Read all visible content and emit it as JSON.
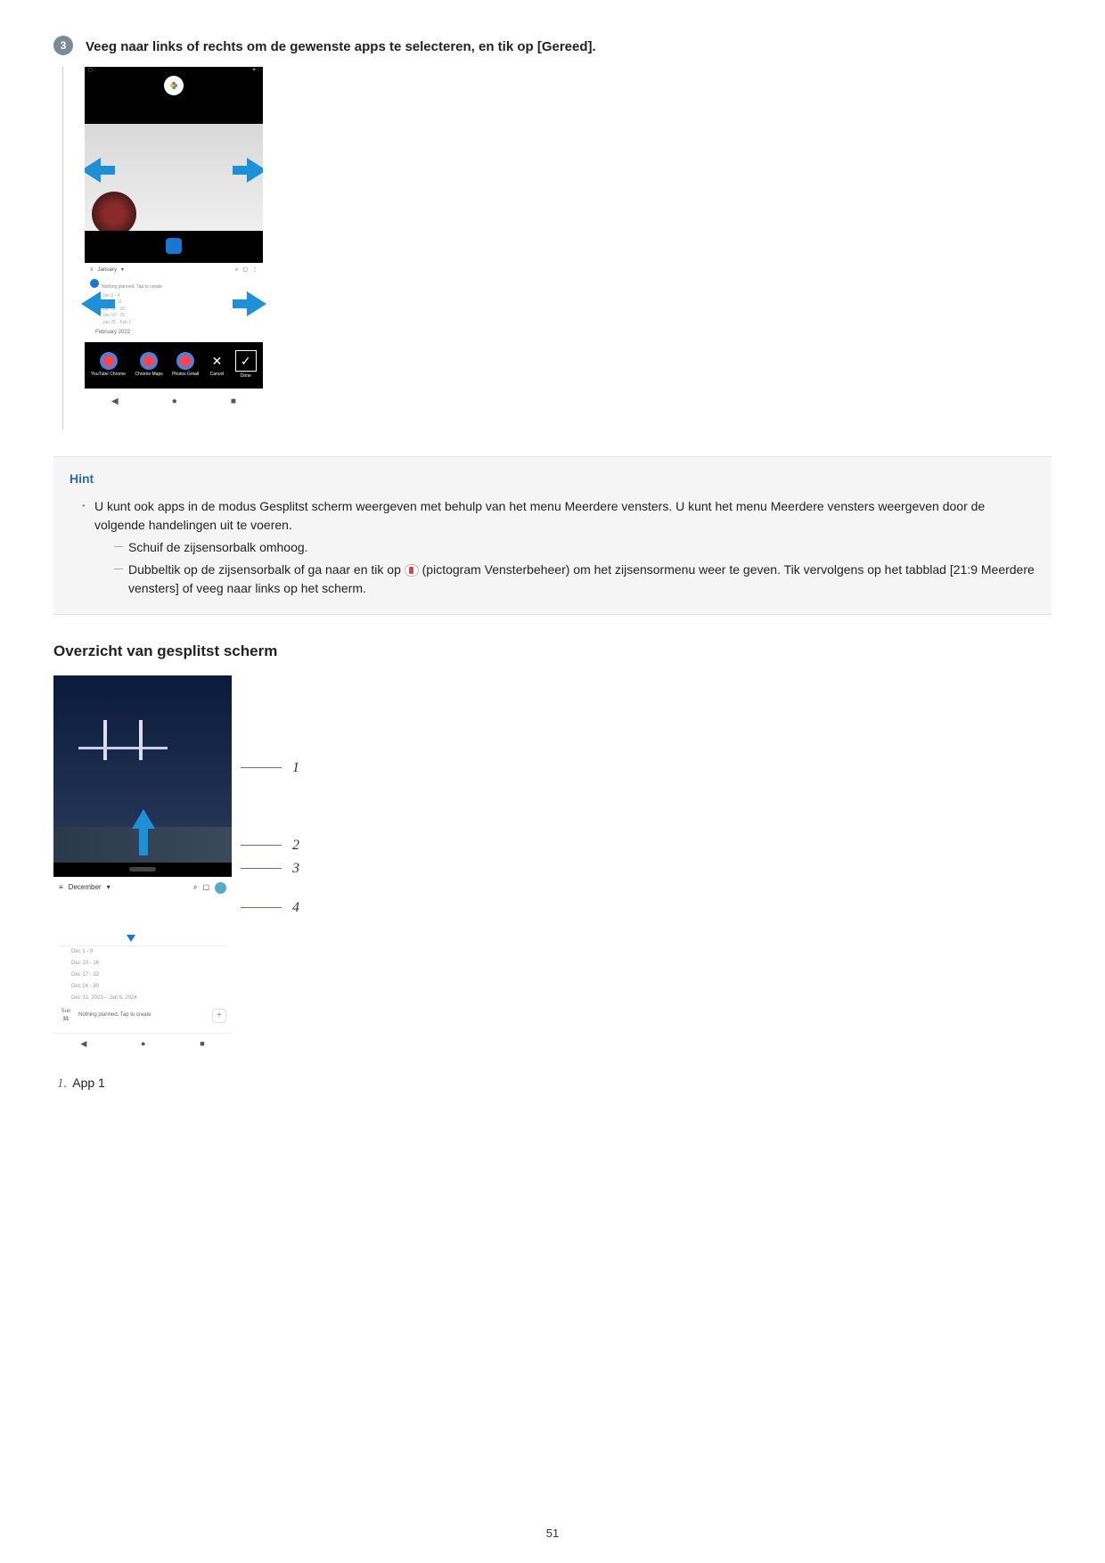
{
  "step3": {
    "number": "3",
    "instruction": "Veeg naar links of rechts om de gewenste apps te selecteren, en tik op [Gereed].",
    "phone": {
      "status_left": "◻ :",
      "status_right": "✦ :",
      "cal_header": "January",
      "cal_subtitle": "Nothing planned. Tap to create",
      "cal_lines": [
        "Jan 1 - 4",
        "Jan 5 - 11",
        "Jan 12 - 18",
        "Jan 19 - 25",
        "Jan 26 - Feb 1"
      ],
      "cal_month": "February 2022",
      "apps": [
        {
          "label": "YouTube Chrome"
        },
        {
          "label": "Chrome Maps"
        },
        {
          "label": "Photos Gmail"
        }
      ],
      "cancel": "Cancel",
      "done": "Done",
      "nav": {
        "back": "◀",
        "home": "●",
        "recent": "■"
      }
    }
  },
  "hint": {
    "title": "Hint",
    "main_text": "U kunt ook apps in de modus Gesplitst scherm weergeven met behulp van het menu Meerdere vensters. U kunt het menu Meerdere vensters weergeven door de volgende handelingen uit te voeren.",
    "sub1": "Schuif de zijsensorbalk omhoog.",
    "sub2_a": "Dubbeltik op de zijsensorbalk of ga naar en tik op ",
    "sub2_b": " (pictogram Vensterbeheer) om het zijsensormenu weer te geven. Tik vervolgens op het tabblad [21:9 Meerdere vensters] of veeg naar links op het scherm."
  },
  "section": {
    "title": "Overzicht van gesplitst scherm",
    "callouts": [
      "1",
      "2",
      "3",
      "4"
    ],
    "phone": {
      "month": "December",
      "lines": [
        "Dec 1 - 9",
        "Dec 10 - 16",
        "Dec 17 - 23",
        "Dec 24 - 30",
        "Dec 31, 2023 – Jan 6, 2024"
      ],
      "today_day": "Sun",
      "today_num": "31",
      "today_text": "Nothing planned. Tap to create",
      "plus": "+",
      "nav": {
        "back": "◀",
        "home": "●",
        "recent": "■"
      }
    }
  },
  "list": {
    "n1": "1.",
    "t1": "App 1"
  },
  "page_number": "51"
}
